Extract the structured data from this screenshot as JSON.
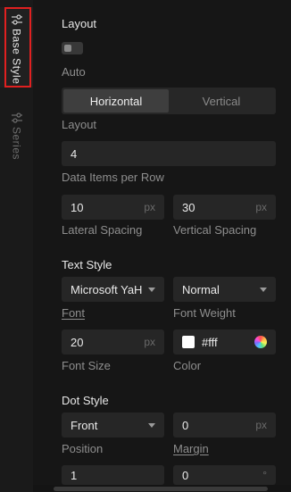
{
  "tabs": [
    {
      "label": "Base Style",
      "icon": "sliders-icon",
      "active": true
    },
    {
      "label": "Series",
      "icon": "sliders-icon",
      "active": false
    }
  ],
  "layout_section": {
    "title": "Layout",
    "auto_label": "Auto",
    "auto_enabled": false,
    "layout_options": [
      "Horizontal",
      "Vertical"
    ],
    "layout_selected": "Horizontal",
    "layout_label": "Layout",
    "data_items_value": "4",
    "data_items_label": "Data Items per Row",
    "lateral_spacing_value": "10",
    "lateral_spacing_unit": "px",
    "lateral_spacing_label": "Lateral Spacing",
    "vertical_spacing_value": "30",
    "vertical_spacing_unit": "px",
    "vertical_spacing_label": "Vertical Spacing"
  },
  "text_style": {
    "title": "Text Style",
    "font_value": "Microsoft YaH",
    "font_label": "Font",
    "font_weight_value": "Normal",
    "font_weight_label": "Font Weight",
    "font_size_value": "20",
    "font_size_unit": "px",
    "font_size_label": "Font Size",
    "color_value": "#fff",
    "color_label": "Color",
    "color_hex": "#ffffff"
  },
  "dot_style": {
    "title": "Dot Style",
    "position_value": "Front",
    "position_label": "Position",
    "margin_value": "0",
    "margin_unit": "px",
    "margin_label": "Margin",
    "next_value_1": "1",
    "next_value_2": "0",
    "next_unit_2": "°"
  }
}
